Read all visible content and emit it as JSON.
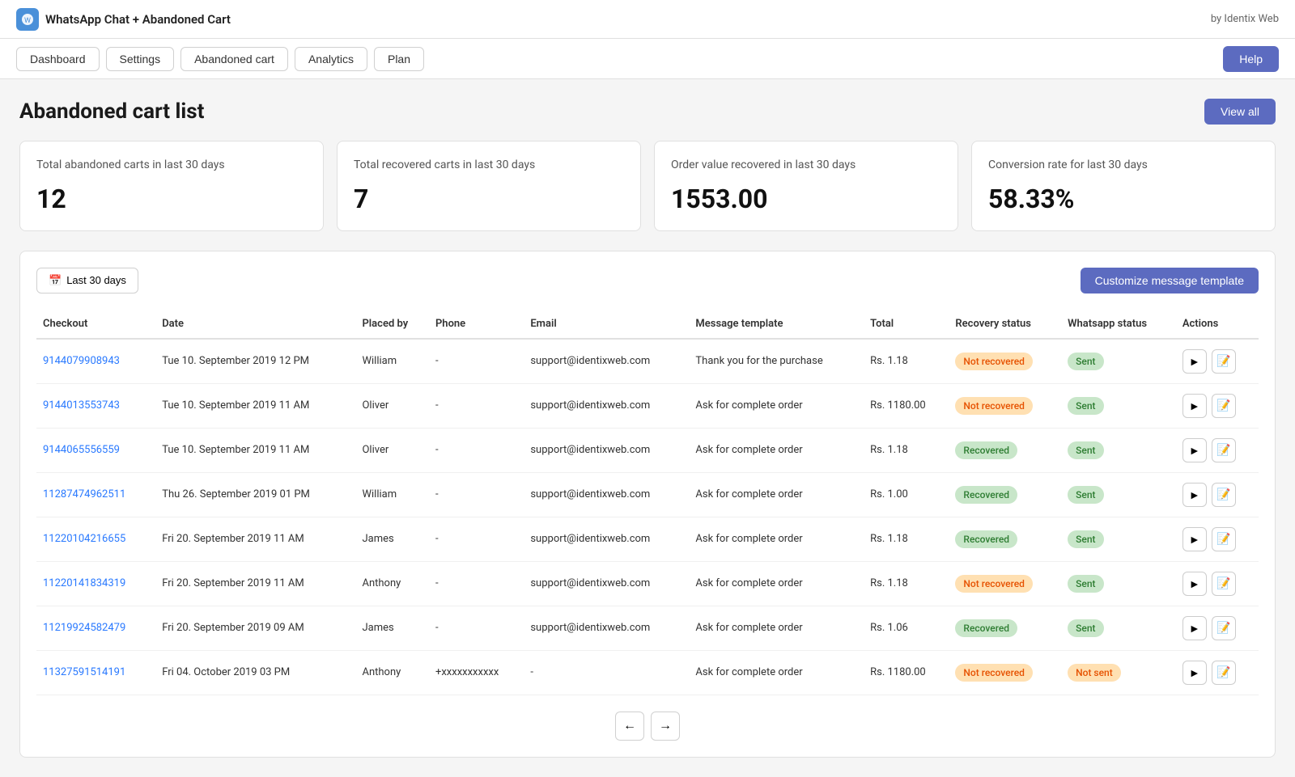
{
  "app": {
    "title": "WhatsApp Chat + Abandoned Cart",
    "byline": "by Identix Web"
  },
  "nav": {
    "items": [
      "Dashboard",
      "Settings",
      "Abandoned cart",
      "Analytics",
      "Plan"
    ],
    "help_label": "Help"
  },
  "page": {
    "title": "Abandoned cart list",
    "view_all_label": "View all"
  },
  "stats": [
    {
      "label": "Total abandoned carts in last 30 days",
      "value": "12"
    },
    {
      "label": "Total recovered carts in last 30 days",
      "value": "7"
    },
    {
      "label": "Order value recovered in last 30 days",
      "value": "1553.00"
    },
    {
      "label": "Conversion rate for last 30 days",
      "value": "58.33%"
    }
  ],
  "table": {
    "date_filter_label": "Last 30 days",
    "customize_btn_label": "Customize message template",
    "columns": [
      "Checkout",
      "Date",
      "Placed by",
      "Phone",
      "Email",
      "Message template",
      "Total",
      "Recovery status",
      "Whatsapp status",
      "Actions"
    ],
    "rows": [
      {
        "checkout": "9144079908943",
        "date": "Tue 10. September 2019 12 PM",
        "placed_by": "William",
        "phone": "-",
        "email": "support@identixweb.com",
        "message_template": "Thank you for the purchase",
        "total": "Rs. 1.18",
        "recovery_status": "Not recovered",
        "recovery_status_type": "not-recovered",
        "whatsapp_status": "Sent",
        "whatsapp_status_type": "sent"
      },
      {
        "checkout": "9144013553743",
        "date": "Tue 10. September 2019 11 AM",
        "placed_by": "Oliver",
        "phone": "-",
        "email": "support@identixweb.com",
        "message_template": "Ask for complete order",
        "total": "Rs. 1180.00",
        "recovery_status": "Not recovered",
        "recovery_status_type": "not-recovered",
        "whatsapp_status": "Sent",
        "whatsapp_status_type": "sent"
      },
      {
        "checkout": "9144065556559",
        "date": "Tue 10. September 2019 11 AM",
        "placed_by": "Oliver",
        "phone": "-",
        "email": "support@identixweb.com",
        "message_template": "Ask for complete order",
        "total": "Rs. 1.18",
        "recovery_status": "Recovered",
        "recovery_status_type": "recovered",
        "whatsapp_status": "Sent",
        "whatsapp_status_type": "sent"
      },
      {
        "checkout": "11287474962511",
        "date": "Thu 26. September 2019 01 PM",
        "placed_by": "William",
        "phone": "-",
        "email": "support@identixweb.com",
        "message_template": "Ask for complete order",
        "total": "Rs. 1.00",
        "recovery_status": "Recovered",
        "recovery_status_type": "recovered",
        "whatsapp_status": "Sent",
        "whatsapp_status_type": "sent"
      },
      {
        "checkout": "11220104216655",
        "date": "Fri 20. September 2019 11 AM",
        "placed_by": "James",
        "phone": "-",
        "email": "support@identixweb.com",
        "message_template": "Ask for complete order",
        "total": "Rs. 1.18",
        "recovery_status": "Recovered",
        "recovery_status_type": "recovered",
        "whatsapp_status": "Sent",
        "whatsapp_status_type": "sent"
      },
      {
        "checkout": "11220141834319",
        "date": "Fri 20. September 2019 11 AM",
        "placed_by": "Anthony",
        "phone": "-",
        "email": "support@identixweb.com",
        "message_template": "Ask for complete order",
        "total": "Rs. 1.18",
        "recovery_status": "Not recovered",
        "recovery_status_type": "not-recovered",
        "whatsapp_status": "Sent",
        "whatsapp_status_type": "sent"
      },
      {
        "checkout": "11219924582479",
        "date": "Fri 20. September 2019 09 AM",
        "placed_by": "James",
        "phone": "-",
        "email": "support@identixweb.com",
        "message_template": "Ask for complete order",
        "total": "Rs. 1.06",
        "recovery_status": "Recovered",
        "recovery_status_type": "recovered",
        "whatsapp_status": "Sent",
        "whatsapp_status_type": "sent"
      },
      {
        "checkout": "11327591514191",
        "date": "Fri 04. October 2019 03 PM",
        "placed_by": "Anthony",
        "phone": "+xxxxxxxxxxx",
        "email": "-",
        "message_template": "Ask for complete order",
        "total": "Rs. 1180.00",
        "recovery_status": "Not recovered",
        "recovery_status_type": "not-recovered",
        "whatsapp_status": "Not sent",
        "whatsapp_status_type": "not-sent"
      }
    ]
  }
}
